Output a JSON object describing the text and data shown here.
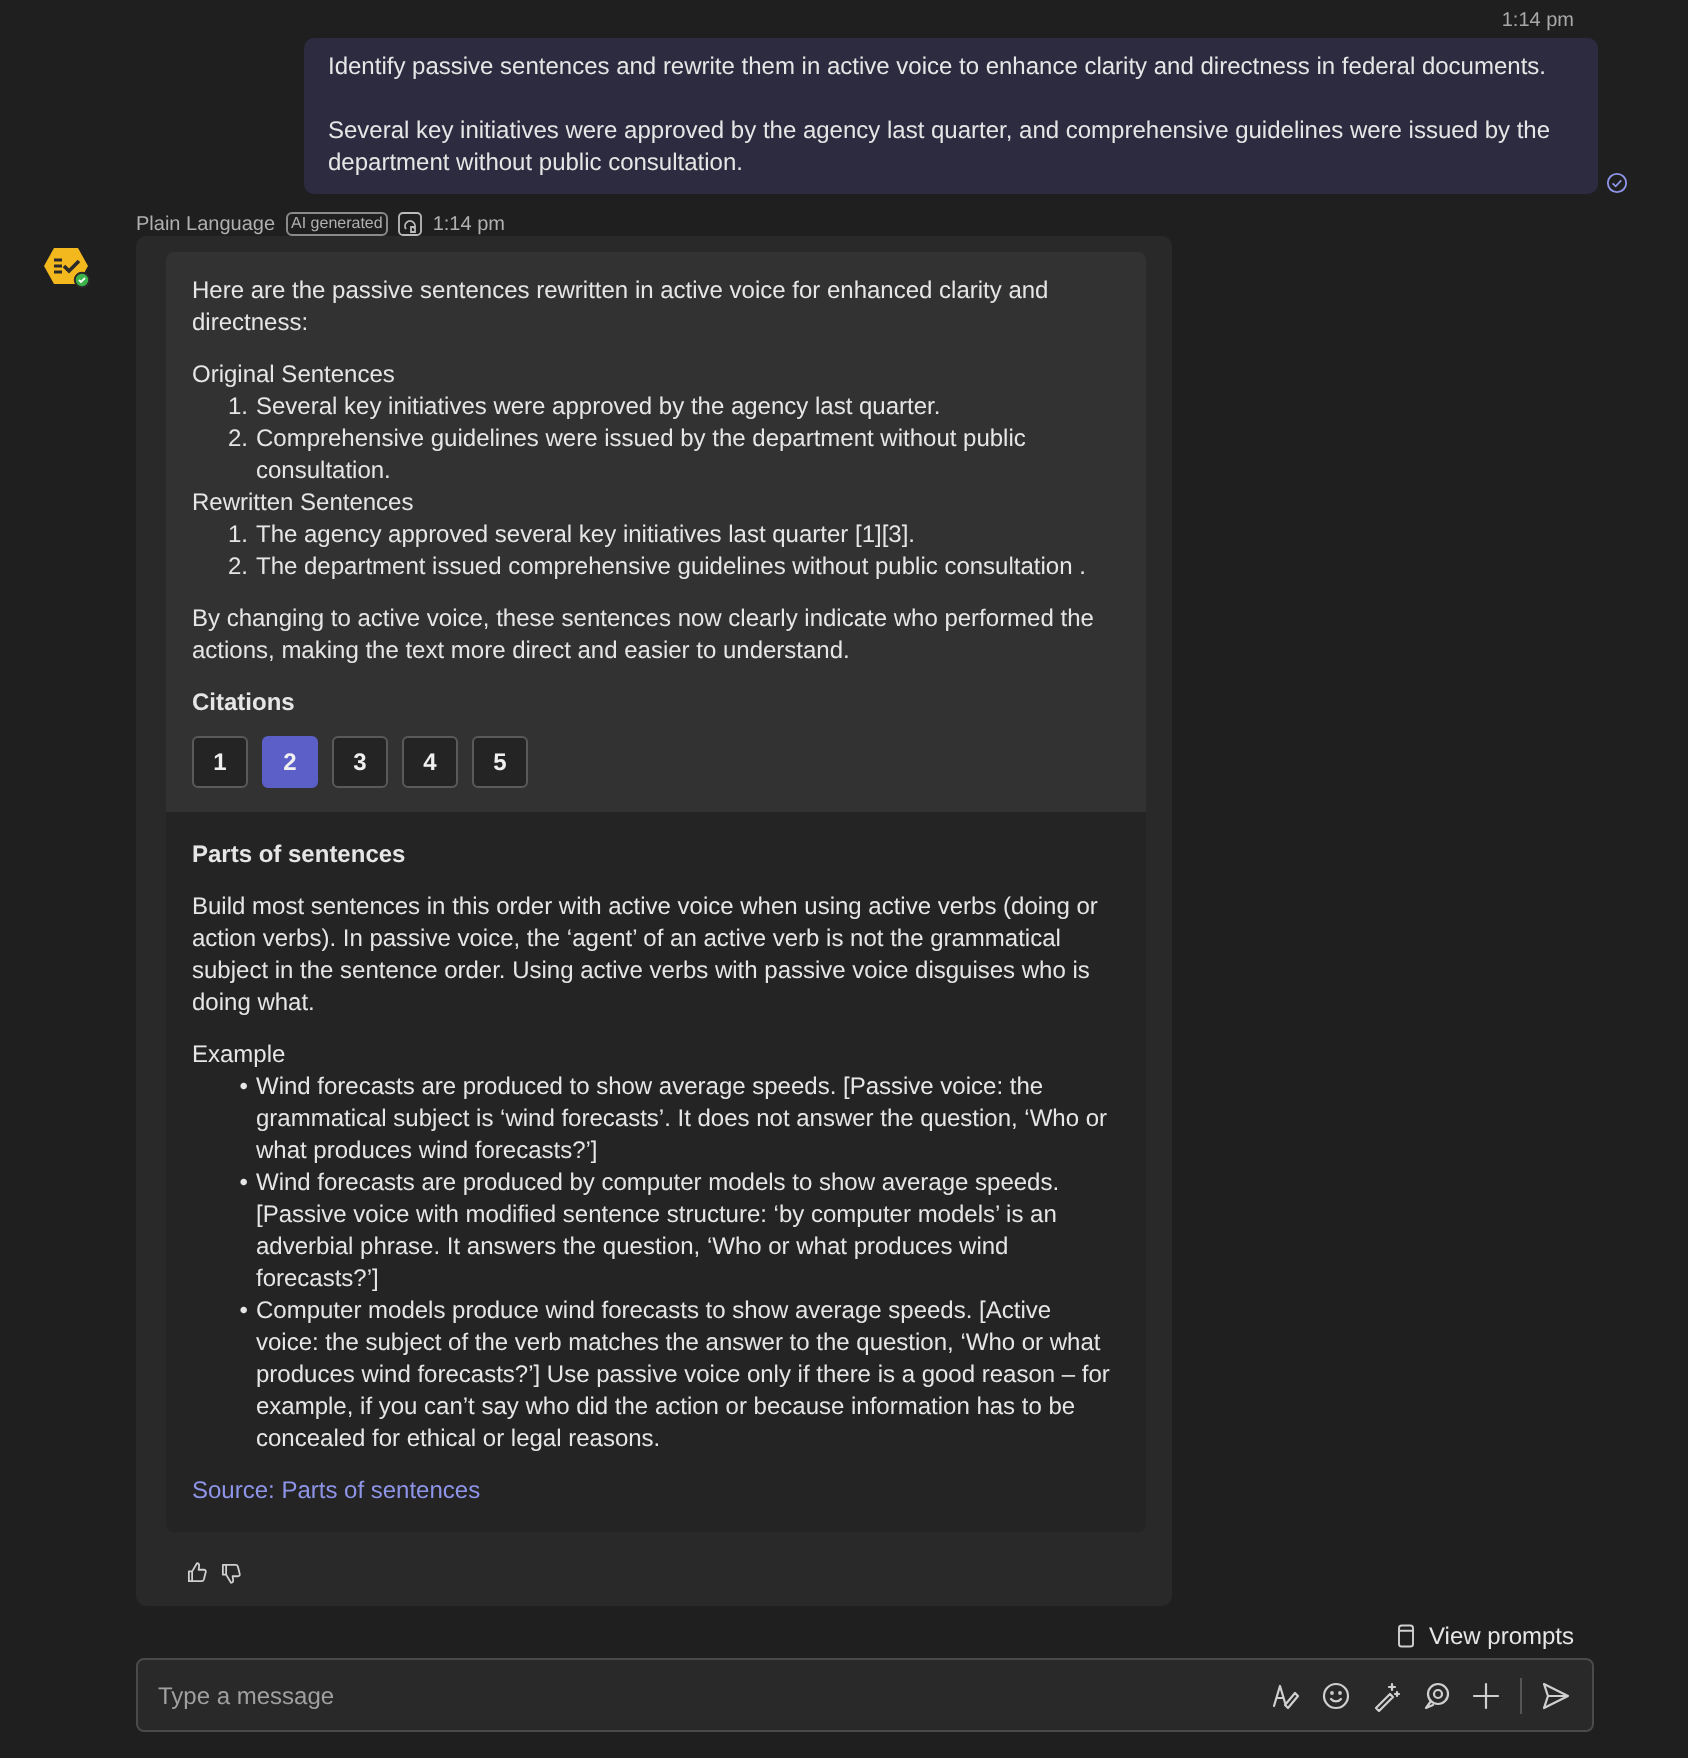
{
  "user_message": {
    "time": "1:14 pm",
    "paragraphs": [
      "Identify passive sentences and rewrite them in active voice to enhance clarity and directness in federal documents.",
      "Several key initiatives were approved by the agency last quarter, and comprehensive guidelines were issued by the department without public consultation."
    ]
  },
  "bot_message": {
    "sender": "Plain Language",
    "badge": "AI generated",
    "time": "1:14 pm",
    "intro": "Here are the passive sentences rewritten in active voice for enhanced clarity and directness:",
    "sections": [
      {
        "heading": "Original Sentences",
        "items": [
          {
            "marker": "1.",
            "text": "Several key initiatives were approved by the agency last quarter."
          },
          {
            "marker": "2.",
            "text": "Comprehensive guidelines were issued by the department without public consultation."
          }
        ]
      },
      {
        "heading": "Rewritten Sentences",
        "items": [
          {
            "marker": "1.",
            "text": "The agency approved several key initiatives last quarter [1][3]."
          },
          {
            "marker": "2.",
            "text": "The department issued comprehensive guidelines without public consultation ."
          }
        ]
      }
    ],
    "conclusion": "By changing to active voice, these sentences now clearly indicate who performed the actions, making the text more direct and easier to understand.",
    "citations_heading": "Citations",
    "citations": [
      {
        "label": "1",
        "selected": false
      },
      {
        "label": "2",
        "selected": true
      },
      {
        "label": "3",
        "selected": false
      },
      {
        "label": "4",
        "selected": false
      },
      {
        "label": "5",
        "selected": false
      }
    ],
    "reference": {
      "title": "Parts of sentences",
      "body": "Build most sentences in this order with active voice when using active verbs (doing or action verbs). In passive voice, the ‘agent’ of an active verb is not the grammatical subject in the sentence order. Using active verbs with passive voice disguises who is doing what.",
      "example_heading": "Example",
      "bullets": [
        {
          "marker": "•",
          "text": "Wind forecasts are produced to show average speeds. [Passive voice: the grammatical subject is ‘wind forecasts’. It does not answer the question, ‘Who or what produces wind forecasts?’]"
        },
        {
          "marker": "•",
          "text": "Wind forecasts are produced by computer models to show average speeds. [Passive voice with modified sentence structure: ‘by computer models’ is an adverbial phrase. It answers the question, ‘Who or what produces wind forecasts?’]"
        },
        {
          "marker": "•",
          "text": "Computer models produce wind forecasts to show average speeds. [Active voice: the subject of the verb matches the answer to the question, ‘Who or what produces wind forecasts?’] Use passive voice only if there is a good reason – for example, if you can’t say who did the action or because information has to be concealed for ethical or legal reasons."
        }
      ],
      "source_link": "Source: Parts of sentences"
    }
  },
  "view_prompts": "View prompts",
  "composer": {
    "placeholder": "Type a message"
  }
}
